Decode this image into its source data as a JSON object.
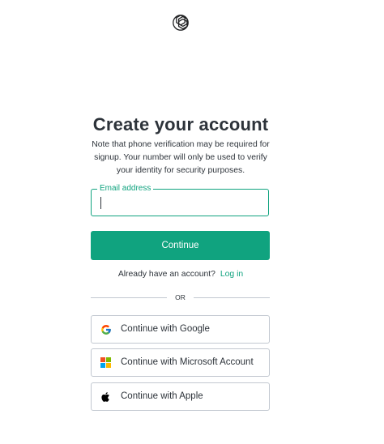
{
  "brand": {
    "logo_icon": "openai-logo-icon"
  },
  "heading": {
    "title": "Create your account",
    "note": "Note that phone verification may be required for signup. Your number will only be used to verify your identity for security purposes."
  },
  "form": {
    "email_label": "Email address",
    "email_value": "",
    "continue_label": "Continue"
  },
  "login": {
    "prompt": "Already have an account?",
    "link_label": "Log in"
  },
  "divider": {
    "text": "OR"
  },
  "social": {
    "google_label": "Continue with Google",
    "microsoft_label": "Continue with Microsoft Account",
    "apple_label": "Continue with Apple"
  },
  "colors": {
    "accent": "#10a37f",
    "text": "#2d333a",
    "border": "#c2c8d0"
  }
}
